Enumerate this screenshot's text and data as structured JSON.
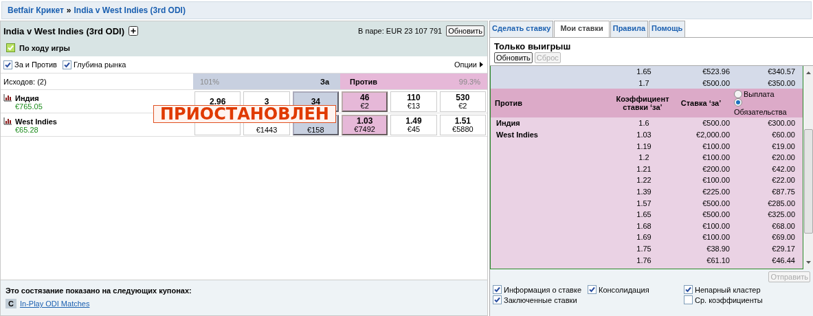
{
  "breadcrumb": [
    {
      "kind": "link",
      "text": "Betfair Крикет"
    },
    {
      "kind": "separator",
      "text": "»"
    },
    {
      "kind": "link",
      "text": "India v West Indies (3rd ODI)"
    }
  ],
  "market": {
    "title": "India v West Indies (3rd ODI)",
    "matched": "В паре: EUR 23 107 791",
    "refresh": "Обновить",
    "in_play": {
      "label": "По ходу игры",
      "checked": true
    },
    "view_options": [
      {
        "label": "За и Против",
        "checked": true
      },
      {
        "label": "Глубина рынка",
        "checked": true
      }
    ],
    "options_menu": "Опции",
    "outcomes": "Исходов:  (2)",
    "back_header": {
      "percent": "101%",
      "label": "За"
    },
    "lay_header": {
      "label": "Против",
      "percent": "99.3%"
    },
    "runners": [
      {
        "name": "Индия",
        "pnl": "€765.05",
        "prices": [
          {
            "kind": "back",
            "price": "2.96",
            "best": false
          },
          {
            "kind": "back",
            "price": "3",
            "best": false
          },
          {
            "kind": "back",
            "price": "34",
            "best": true
          },
          {
            "kind": "lay",
            "price": "46",
            "amount": "€2",
            "best": true
          },
          {
            "kind": "lay",
            "price": "110",
            "amount": "€13",
            "best": false
          },
          {
            "kind": "lay",
            "price": "530",
            "amount": "€2",
            "best": false
          }
        ]
      },
      {
        "name": "West Indies",
        "pnl": "€65.28",
        "prices": [
          {
            "kind": "back",
            "best": false
          },
          {
            "kind": "back",
            "amount": "€1443",
            "best": false
          },
          {
            "kind": "back",
            "amount": "€158",
            "best": true
          },
          {
            "kind": "lay",
            "price": "1.03",
            "amount": "€7492",
            "best": true
          },
          {
            "kind": "lay",
            "price": "1.49",
            "amount": "€45",
            "best": false
          },
          {
            "kind": "lay",
            "price": "1.51",
            "amount": "€5880",
            "best": false
          }
        ]
      }
    ],
    "suspended": "ПРИОСТАНОВЛЕН"
  },
  "coupons": {
    "heading": "Это состязание показано на следующих купонах:",
    "items": [
      {
        "badge": "C",
        "link": "In-Play ODI Matches"
      }
    ]
  },
  "bet_panel": {
    "tabs": [
      {
        "label": "Сделать ставку",
        "selected": false
      },
      {
        "label": "Мои ставки",
        "selected": true
      },
      {
        "label": "Правила",
        "selected": false
      },
      {
        "label": "Помощь",
        "selected": false
      }
    ],
    "title": "Только выигрыш",
    "buttons": [
      {
        "label": "Обновить",
        "disabled": false
      },
      {
        "label": "Сброс",
        "disabled": true
      }
    ],
    "back_rows": [
      {
        "odds": "1.65",
        "stake": "€523.96",
        "value": "€340.57"
      },
      {
        "odds": "1.7",
        "stake": "€500.00",
        "value": "€350.00"
      }
    ],
    "lay_header": {
      "label": "Против",
      "odds": "Коэффициент ставки ‘за’",
      "stake": "Ставка ‘за’",
      "radios": [
        {
          "label": "Выплата",
          "selected": false
        },
        {
          "label": "Обязательства",
          "selected": true
        }
      ]
    },
    "lay_rows": [
      {
        "runner": "Индия",
        "odds": "1.6",
        "stake": "€500.00",
        "value": "€300.00"
      },
      {
        "runner": "West Indies",
        "odds": "1.03",
        "stake": "€2,000.00",
        "value": "€60.00"
      },
      {
        "odds": "1.19",
        "stake": "€100.00",
        "value": "€19.00"
      },
      {
        "odds": "1.2",
        "stake": "€100.00",
        "value": "€20.00"
      },
      {
        "odds": "1.21",
        "stake": "€200.00",
        "value": "€42.00"
      },
      {
        "odds": "1.22",
        "stake": "€100.00",
        "value": "€22.00"
      },
      {
        "odds": "1.39",
        "stake": "€225.00",
        "value": "€87.75"
      },
      {
        "odds": "1.57",
        "stake": "€500.00",
        "value": "€285.00"
      },
      {
        "odds": "1.65",
        "stake": "€500.00",
        "value": "€325.00"
      },
      {
        "odds": "1.68",
        "stake": "€100.00",
        "value": "€68.00"
      },
      {
        "odds": "1.69",
        "stake": "€100.00",
        "value": "€69.00"
      },
      {
        "odds": "1.75",
        "stake": "€38.90",
        "value": "€29.17"
      },
      {
        "odds": "1.76",
        "stake": "€61.10",
        "value": "€46.44"
      }
    ],
    "submit": {
      "label": "Отправить",
      "disabled": true
    },
    "options": [
      {
        "label": "Информация о ставке",
        "checked": true
      },
      {
        "label": "Консолидация",
        "checked": true
      },
      {
        "label": "Непарный кластер",
        "checked": true
      },
      {
        "label": "Заключенные ставки",
        "checked": true
      },
      {
        "label": "Ср. коэффициенты",
        "checked": false
      }
    ]
  }
}
